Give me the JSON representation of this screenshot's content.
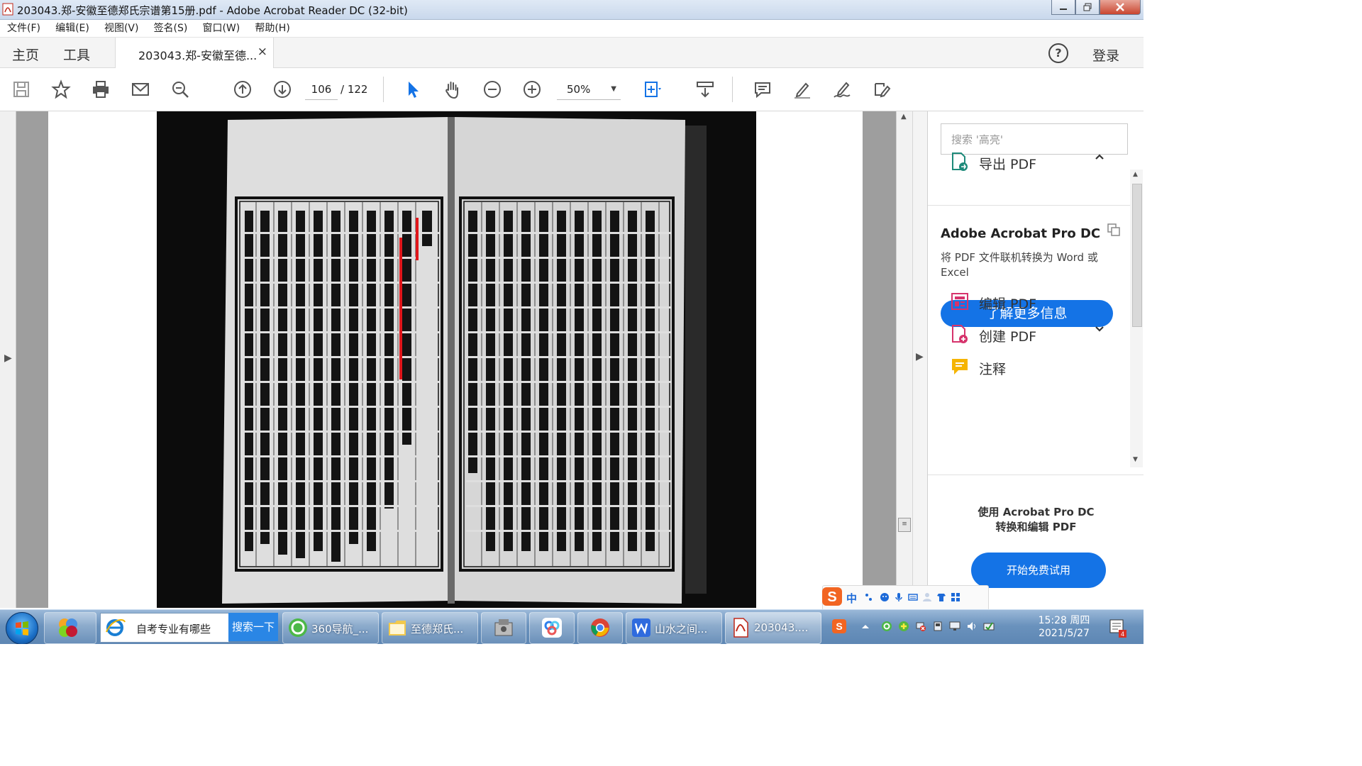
{
  "window": {
    "title": "203043.郑-安徽至德郑氏宗谱第15册.pdf - Adobe Acrobat Reader DC (32-bit)"
  },
  "menu": [
    "文件(F)",
    "编辑(E)",
    "视图(V)",
    "签名(S)",
    "窗口(W)",
    "帮助(H)"
  ],
  "tabs": {
    "home": "主页",
    "tools": "工具",
    "document": "203043.郑-安徽至德...",
    "close_glyph": "×",
    "help_glyph": "?",
    "login": "登录"
  },
  "toolbar": {
    "page_current": "106",
    "page_total": "/ 122",
    "zoom": "50%"
  },
  "right_panel": {
    "search_placeholder": "搜索 '高亮'",
    "export_pdf": "导出 PDF",
    "promo_title": "Adobe Acrobat Pro DC",
    "promo_body": "将 PDF 文件联机转换为 Word 或 Excel",
    "learn_more": "了解更多信息",
    "edit_pdf": "编辑 PDF",
    "create_pdf": "创建 PDF",
    "comment": "注释",
    "promo2_line1": "使用 Acrobat Pro DC",
    "promo2_line2": "转换和编辑 PDF",
    "free_trial": "开始免费试用"
  },
  "ime": {
    "mode": "中"
  },
  "taskbar": {
    "search_text": "自考专业有哪些",
    "search_button": "搜索一下",
    "items": [
      "360导航_...",
      "至德郑氏...",
      "山水之间...",
      "203043...."
    ],
    "time": "15:28 周四",
    "date": "2021/5/27",
    "notify_count": "4"
  },
  "colors": {
    "accent_blue": "#1473e6",
    "taskbar": "#6a92bd",
    "scan_background": "#0c0c0c"
  }
}
